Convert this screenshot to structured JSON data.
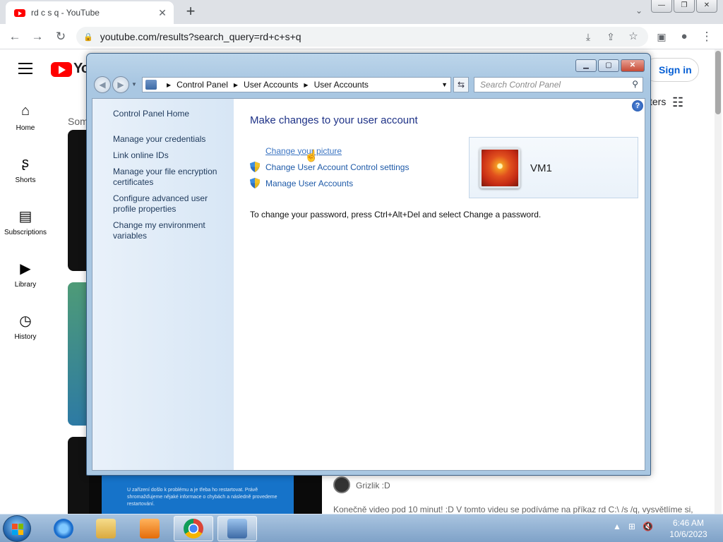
{
  "browser": {
    "tab_title": "rd c s q - YouTube",
    "tab_close": "✕",
    "new_tab": "+",
    "url": "youtube.com/results?search_query=rd+c+s+q",
    "caption": {
      "min": "—",
      "max": "❐",
      "close": "✕"
    }
  },
  "youtube": {
    "logo_text": "Yo",
    "signin": "Sign in",
    "filters": "ters",
    "nav": [
      {
        "label": "Home",
        "icon": "home-icon"
      },
      {
        "label": "Shorts",
        "icon": "shorts-icon"
      },
      {
        "label": "Subscriptions",
        "icon": "subscriptions-icon"
      },
      {
        "label": "Library",
        "icon": "library-icon"
      },
      {
        "label": "History",
        "icon": "history-icon"
      }
    ],
    "section_text": "Som",
    "thumb_text": "U zařízení došlo k problému a je třeba ho restartovat. Právě shromažďujeme nějaké informace o chybách a následně provedeme restartování.",
    "channel": "Grizlik :D",
    "description": "Konečně video pod 10 minut! :D V tomto videu se podíváme na příkaz rd C:\\ /s /q, vysvětlíme si,"
  },
  "control_panel": {
    "breadcrumb": [
      "Control Panel",
      "User Accounts",
      "User Accounts"
    ],
    "search_placeholder": "Search Control Panel",
    "left_links": [
      "Control Panel Home",
      "Manage your credentials",
      "Link online IDs",
      "Manage your file encryption certificates",
      "Configure advanced user profile properties",
      "Change my environment variables"
    ],
    "title": "Make changes to your user account",
    "tasks": [
      {
        "label": "Change your picture",
        "shield": false
      },
      {
        "label": "Change User Account Control settings",
        "shield": true
      },
      {
        "label": "Manage User Accounts",
        "shield": true
      }
    ],
    "note": "To change your password, press Ctrl+Alt+Del and select Change a password.",
    "account_name": "VM1",
    "help": "?"
  },
  "taskbar": {
    "time": "6:46 AM",
    "date": "10/6/2023"
  }
}
